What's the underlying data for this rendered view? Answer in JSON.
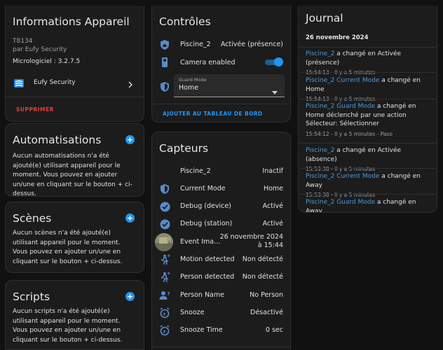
{
  "device": {
    "title": "Informations Appareil",
    "model": "T8134",
    "manufacturer": "par Eufy Security",
    "firmware": "Micrologiciel : 3.2.7.5",
    "integration": "Eufy Security",
    "delete": "SUPPRIMER"
  },
  "automations": {
    "title": "Automatisations",
    "text": "Aucun automatisations n'a été ajouté(e) utilisant appareil pour le moment. Vous pouvez en ajouter un/une en cliquant sur le bouton + ci-dessus."
  },
  "scenes": {
    "title": "Scènes",
    "text": "Aucun scènes n'a été ajouté(e) utilisant appareil pour le moment. Vous pouvez en ajouter un/une en cliquant sur le bouton + ci-dessus."
  },
  "scripts": {
    "title": "Scripts",
    "text": "Aucun scripts n'a été ajouté(e) utilisant appareil pour le moment. Vous pouvez en ajouter un/une en cliquant sur le bouton + ci-dessus."
  },
  "controls": {
    "title": "Contrôles",
    "piscine_label": "Piscine_2",
    "piscine_value": "Activée (présence)",
    "camera_label": "Camera enabled",
    "camera_on": true,
    "guard_mode_label": "Guard Mode",
    "guard_mode_value": "Home",
    "add_dashboard": "AJOUTER AU TABLEAU DE BORD"
  },
  "sensors": {
    "title": "Capteurs",
    "rows": [
      {
        "icon": "none",
        "label": "Piscine_2",
        "value": "Inactif"
      },
      {
        "icon": "shield-icon",
        "label": "Current Mode",
        "value": "Home"
      },
      {
        "icon": "check-circle-icon",
        "label": "Debug (device)",
        "value": "Activé"
      },
      {
        "icon": "check-circle-icon",
        "label": "Debug (station)",
        "value": "Activé"
      },
      {
        "icon": "thumbnail",
        "label": "Event Ima…",
        "value": "26 novembre 2024 à 15:44"
      },
      {
        "icon": "motion-icon",
        "label": "Motion detected",
        "value": "Non détecté"
      },
      {
        "icon": "motion-icon",
        "label": "Person detected",
        "value": "Non détecté"
      },
      {
        "icon": "person-question-icon",
        "label": "Person Name",
        "value": "No Person"
      },
      {
        "icon": "alarm-icon",
        "label": "Snooze",
        "value": "Désactivé"
      },
      {
        "icon": "alarm-icon",
        "label": "Snooze Time",
        "value": "0 sec"
      }
    ]
  },
  "journal": {
    "title": "Journal",
    "date": "26 novembre 2024",
    "entries": [
      {
        "entity": "Piscine_2",
        "text": " a changé en Activée (présence)",
        "meta": "15:54:13 - Il y a 5 minutes"
      },
      {
        "entity": "Piscine_2 Current Mode",
        "text": " a changé en Home",
        "meta": "15:54:13 - Il y a 5 minutes"
      },
      {
        "entity": "Piscine_2 Guard Mode",
        "text": " a changé en Home déclenché par une action Sélecteur: Sélectionner",
        "meta": "15:54:12 - Il y a 5 minutes - Paso"
      },
      {
        "entity": "Piscine_2",
        "text": " a changé en Activée (absence)",
        "meta": "15:53:38 - Il y a 5 minutes"
      },
      {
        "entity": "Piscine_2 Current Mode",
        "text": " a changé en Away",
        "meta": "15:53:38 - Il y a 5 minutes"
      },
      {
        "entity": "Piscine_2 Guard Mode",
        "text": " a changé en Away",
        "meta": ""
      }
    ]
  },
  "colors": {
    "accent": "#2196f3",
    "danger": "#db4437",
    "link": "#4a9ad8"
  }
}
